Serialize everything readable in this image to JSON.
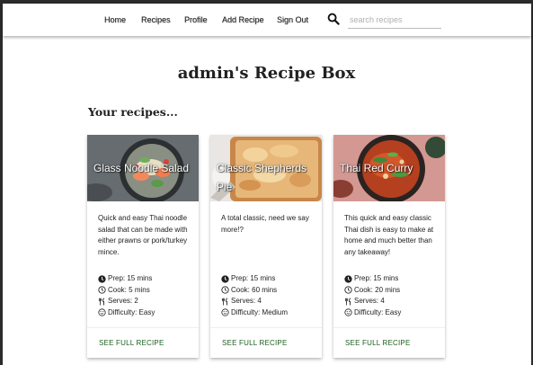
{
  "nav": {
    "links": [
      "Home",
      "Recipes",
      "Profile",
      "Add Recipe",
      "Sign Out"
    ],
    "search_placeholder": "search recipes"
  },
  "page_title": "admin's Recipe Box",
  "section_title": "Your recipes...",
  "stat_labels": {
    "prep": "Prep:",
    "cook": "Cook:",
    "serves": "Serves:",
    "difficulty": "Difficulty:"
  },
  "cards": [
    {
      "title": "Glass Noodle Salad",
      "description": "Quick and easy Thai noodle salad that can be made with either prawns or pork/turkey mince.",
      "prep": "15 mins",
      "cook": "5 mins",
      "serves": "2",
      "difficulty": "Easy",
      "link": "SEE FULL RECIPE"
    },
    {
      "title": "Classic Shepherds Pie",
      "description": "A total classic, need we say more!?",
      "prep": "15 mins",
      "cook": "60 mins",
      "serves": "4",
      "difficulty": "Medium",
      "link": "SEE FULL RECIPE"
    },
    {
      "title": "Thai Red Curry",
      "description": "This quick and easy classic Thai dish is easy to make at home and much better than any takeaway!",
      "prep": "15 mins",
      "cook": "20 mins",
      "serves": "4",
      "difficulty": "Easy",
      "link": "SEE FULL RECIPE"
    }
  ],
  "colors": {
    "link_green": "#1b5e20",
    "text": "#212121",
    "placeholder": "#b0b0b0"
  }
}
